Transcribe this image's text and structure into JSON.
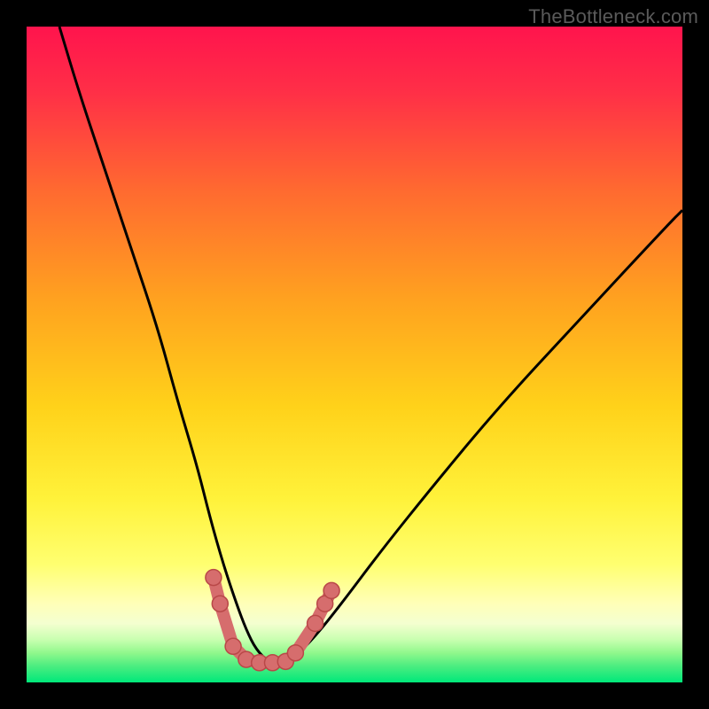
{
  "watermark": "TheBottleneck.com",
  "colors": {
    "top": "#ff1a4a",
    "mid1": "#ff7a2a",
    "mid2": "#ffd400",
    "mid3": "#ffff55",
    "pale": "#ffffb0",
    "green1": "#7ff56a",
    "green2": "#00e87a",
    "curve": "#000000",
    "marker": "#d66d6d",
    "marker_stroke": "#b94848"
  },
  "chart_data": {
    "type": "line",
    "title": "",
    "xlabel": "",
    "ylabel": "",
    "xlim": [
      0,
      100
    ],
    "ylim": [
      0,
      100
    ],
    "series": [
      {
        "name": "bottleneck-curve",
        "x": [
          5,
          8,
          12,
          16,
          20,
          23,
          26,
          28,
          30,
          32,
          33.5,
          35,
          37,
          39,
          41,
          44,
          48,
          54,
          62,
          72,
          84,
          98,
          100
        ],
        "y": [
          100,
          90,
          78,
          66,
          54,
          43,
          33,
          25,
          18,
          12,
          8,
          5,
          3,
          3,
          4,
          7,
          12,
          20,
          30,
          42,
          55,
          70,
          72
        ]
      }
    ],
    "markers": [
      {
        "x": 28.5,
        "y": 16
      },
      {
        "x": 29.5,
        "y": 12
      },
      {
        "x": 31.5,
        "y": 5.5
      },
      {
        "x": 33.5,
        "y": 3.5
      },
      {
        "x": 35.5,
        "y": 3
      },
      {
        "x": 37.5,
        "y": 3
      },
      {
        "x": 39.5,
        "y": 3.2
      },
      {
        "x": 41,
        "y": 4.5
      },
      {
        "x": 44,
        "y": 9
      },
      {
        "x": 45.5,
        "y": 12
      },
      {
        "x": 46.5,
        "y": 14
      }
    ],
    "minimum_x": 37,
    "minimum_y": 3
  }
}
